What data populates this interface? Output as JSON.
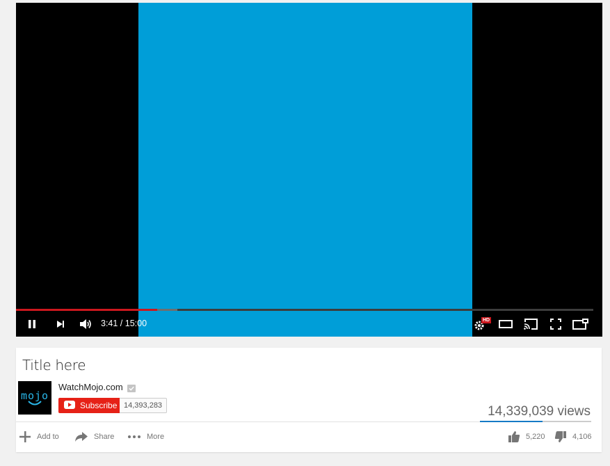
{
  "player": {
    "time_current": "3:41",
    "time_total": "15:00",
    "time_display": "3:41 / 15:00",
    "progress_played": 0.245,
    "progress_buffered": 0.28,
    "hd_badge": "HD",
    "colors": {
      "frame": "#009ed8",
      "played": "#cc181e",
      "background": "#000000"
    },
    "icons": [
      "pause-icon",
      "next-icon",
      "volume-icon",
      "settings-icon",
      "theater-mode-icon",
      "cast-icon",
      "fullscreen-icon",
      "miniplayer-icon"
    ]
  },
  "video": {
    "title": "Title here",
    "views": "14,339,039 views",
    "like_ratio": 0.56
  },
  "channel": {
    "name": "WatchMojo.com",
    "avatar_text": "mojo",
    "subscribe_label": "Subscribe",
    "subscriber_count": "14,393,283",
    "brand_color": "#e62117"
  },
  "actions": {
    "add_to": "Add to",
    "share": "Share",
    "more": "More",
    "likes": "5,220",
    "dislikes": "4,106"
  }
}
